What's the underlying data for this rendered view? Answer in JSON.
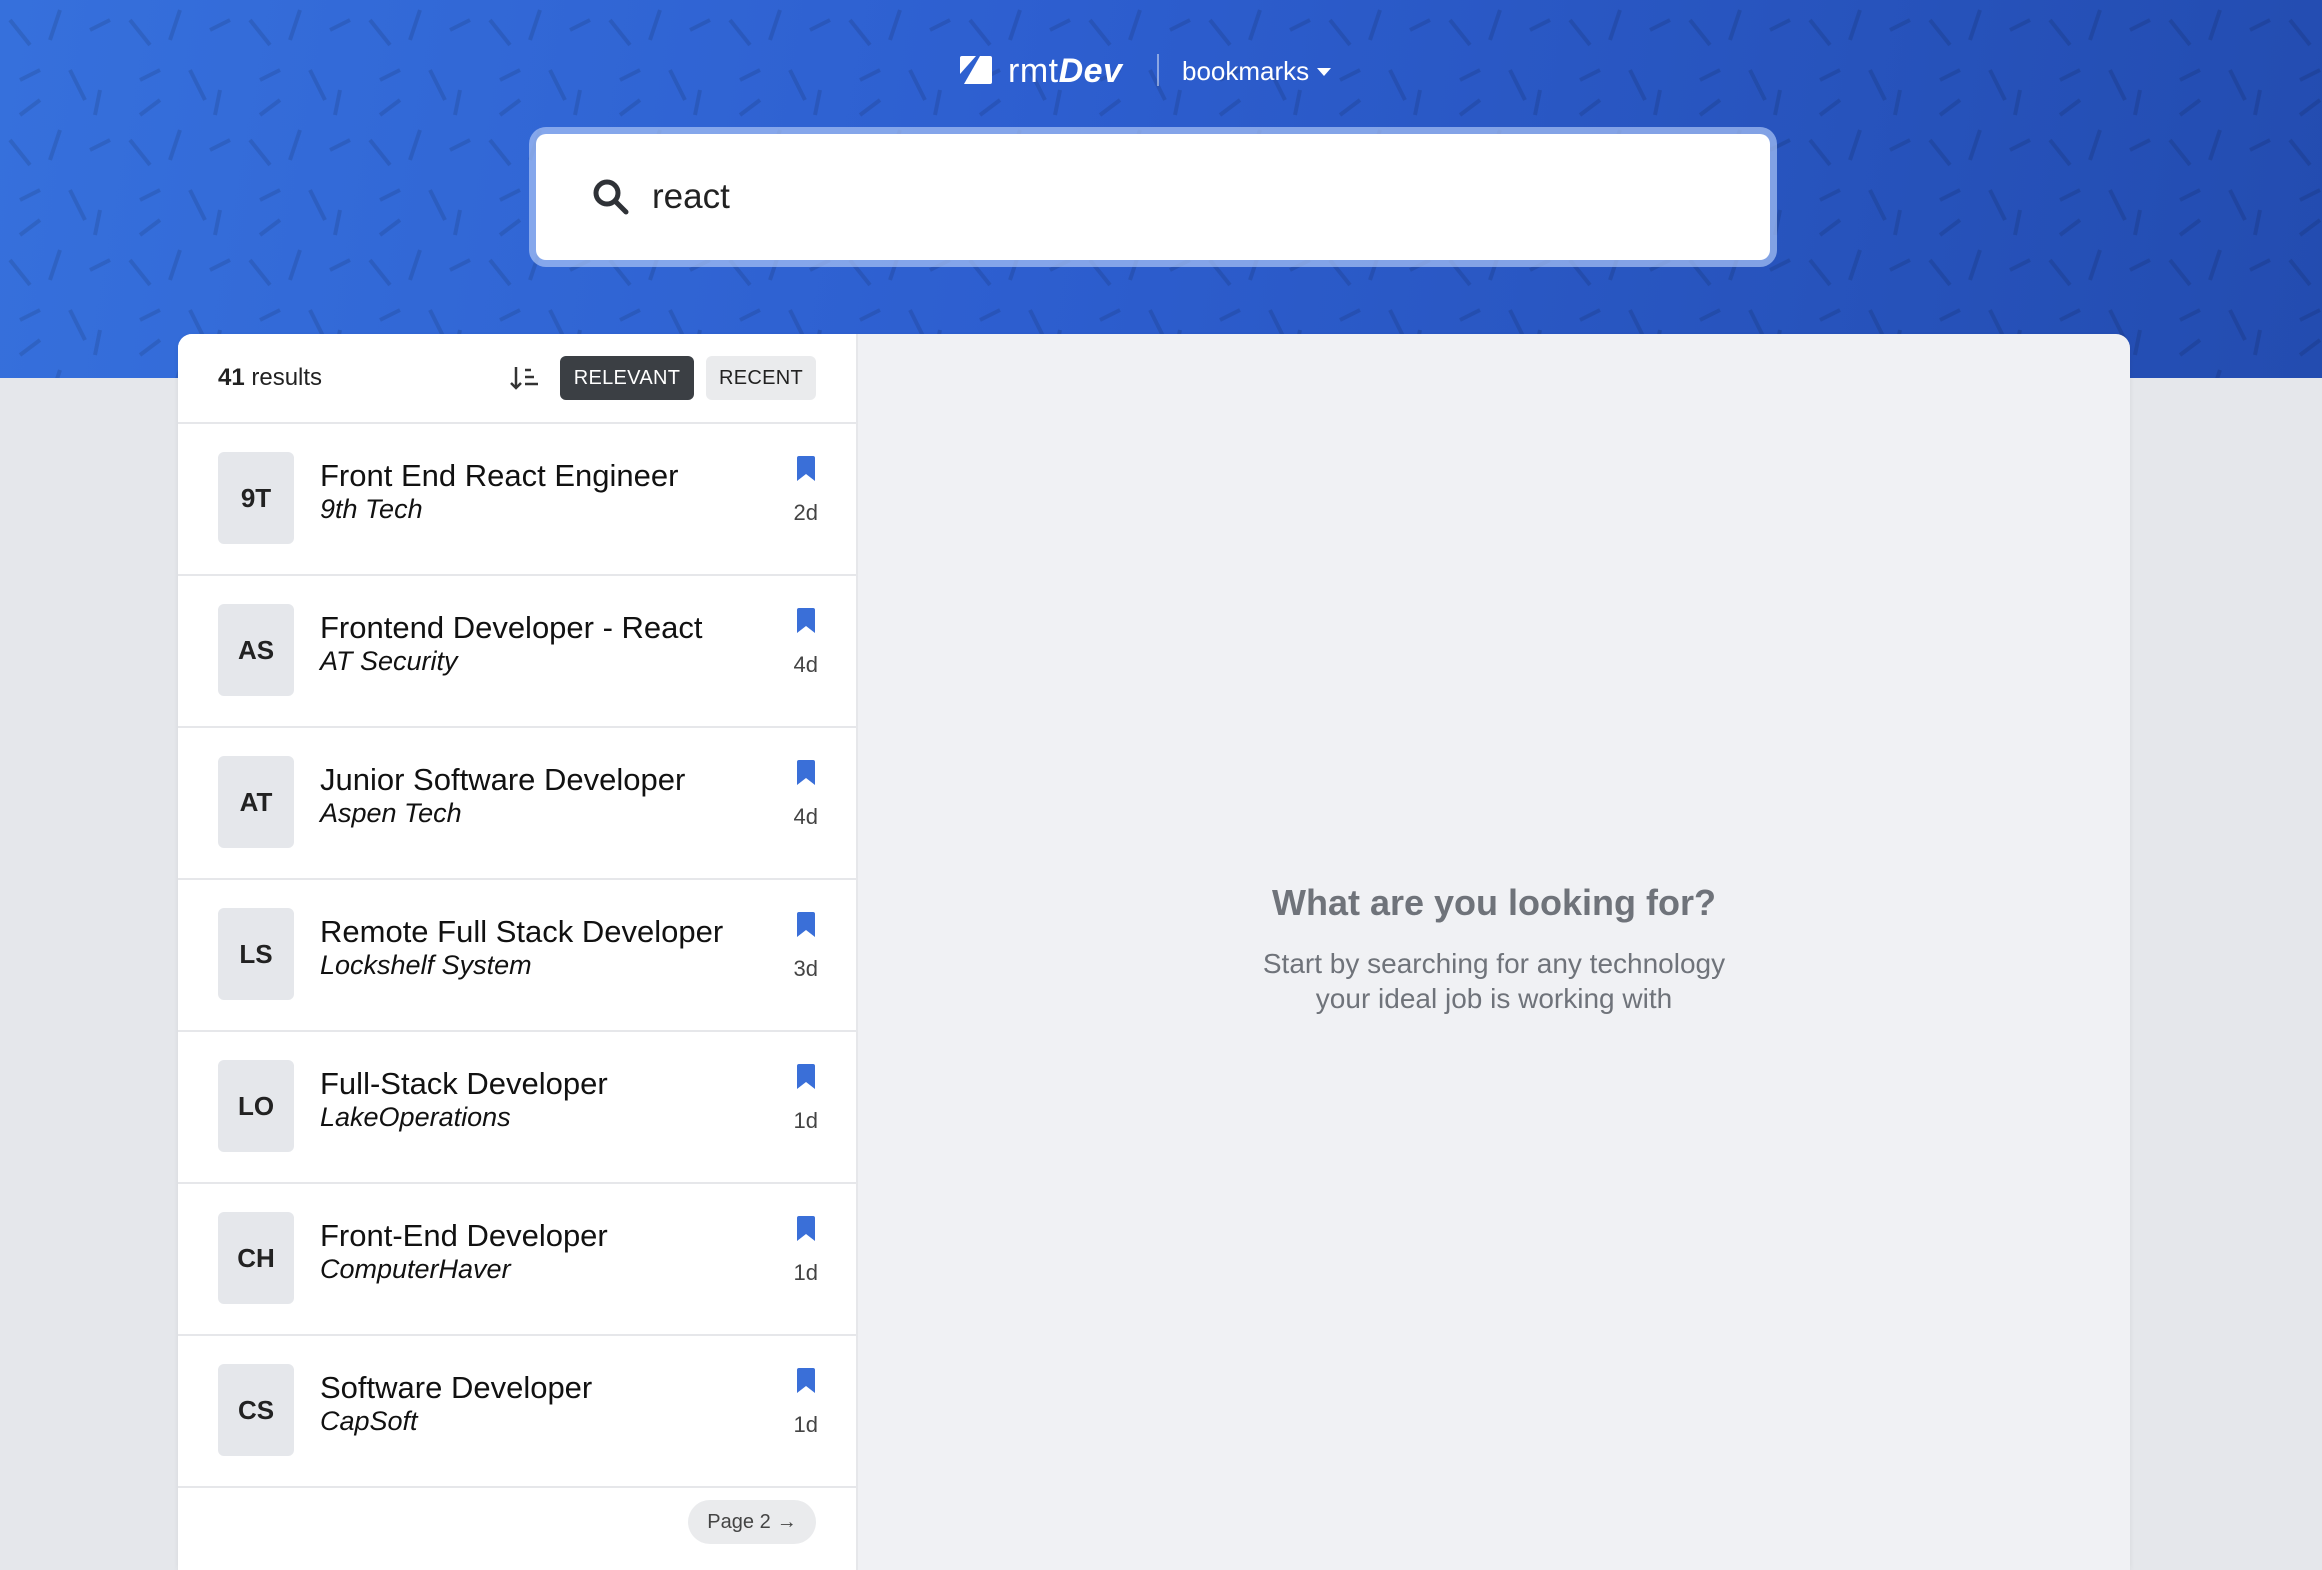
{
  "header": {
    "logo_light": "rmt",
    "logo_bold": "Dev",
    "bookmarks_label": "bookmarks"
  },
  "search": {
    "value": "react",
    "placeholder": ""
  },
  "results": {
    "count": "41",
    "suffix": " results"
  },
  "sort": {
    "relevant_label": "RELEVANT",
    "recent_label": "RECENT",
    "active": "relevant"
  },
  "jobs": [
    {
      "badge": "9T",
      "title": "Front End React Engineer",
      "company": "9th Tech",
      "days": "2d"
    },
    {
      "badge": "AS",
      "title": "Frontend Developer - React",
      "company": "AT Security",
      "days": "4d"
    },
    {
      "badge": "AT",
      "title": "Junior Software Developer",
      "company": "Aspen Tech",
      "days": "4d"
    },
    {
      "badge": "LS",
      "title": "Remote Full Stack Developer",
      "company": "Lockshelf System",
      "days": "3d"
    },
    {
      "badge": "LO",
      "title": "Full-Stack Developer",
      "company": "LakeOperations",
      "days": "1d"
    },
    {
      "badge": "CH",
      "title": "Front-End Developer",
      "company": "ComputerHaver",
      "days": "1d"
    },
    {
      "badge": "CS",
      "title": "Software Developer",
      "company": "CapSoft",
      "days": "1d"
    }
  ],
  "pagination": {
    "next_label": "Page 2",
    "arrow": "→"
  },
  "empty_state": {
    "heading": "What are you looking for?",
    "line1": "Start by searching for any technology",
    "line2": "your ideal job is working with"
  },
  "colors": {
    "header_blue": "#2d5ecf",
    "bookmark_blue": "#3a6fd8",
    "active_sort": "#3b3f44"
  },
  "icons": {
    "logo": "logo-icon",
    "search": "search-icon",
    "sort": "sort-icon",
    "bookmark": "bookmark-icon",
    "caret": "caret-down-icon"
  }
}
